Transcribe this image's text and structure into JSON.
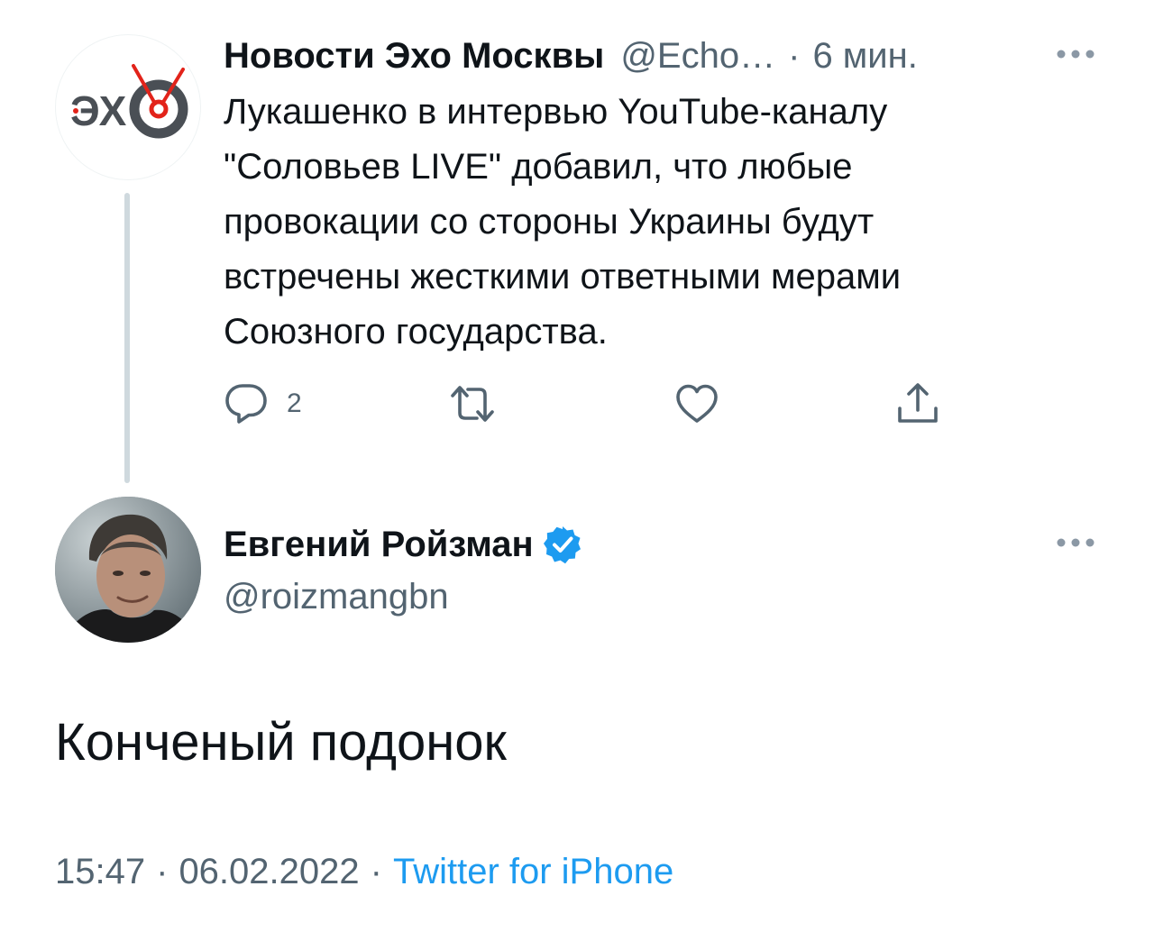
{
  "parent_tweet": {
    "author_name": "Новости Эхо Москвы",
    "handle": "@Echo…",
    "separator": "·",
    "time_ago": "6 мин.",
    "avatar_icon": "echo-moskvy-logo",
    "text_lines": [
      "Лукашенко в интервью YouTube-каналу",
      "\"Соловьев LIVE\" добавил, что любые",
      "провокации со стороны Украины будут",
      "встречены жесткими ответными мерами",
      "Союзного государства."
    ],
    "actions": {
      "reply_icon": "reply-icon",
      "reply_count": "2",
      "retweet_icon": "retweet-icon",
      "like_icon": "heart-icon",
      "share_icon": "share-icon"
    }
  },
  "main_tweet": {
    "author_name": "Евгений Ройзман",
    "verified": true,
    "handle": "@roizmangbn",
    "text": "Конченый подонок",
    "time": "15:47",
    "date": "06.02.2022",
    "separator": "·",
    "source": "Twitter for iPhone"
  },
  "colors": {
    "text_primary": "#0f1419",
    "text_secondary": "#536471",
    "accent": "#1d9bf0",
    "thread_line": "#cfd9de",
    "echo_red": "#e2231a"
  }
}
